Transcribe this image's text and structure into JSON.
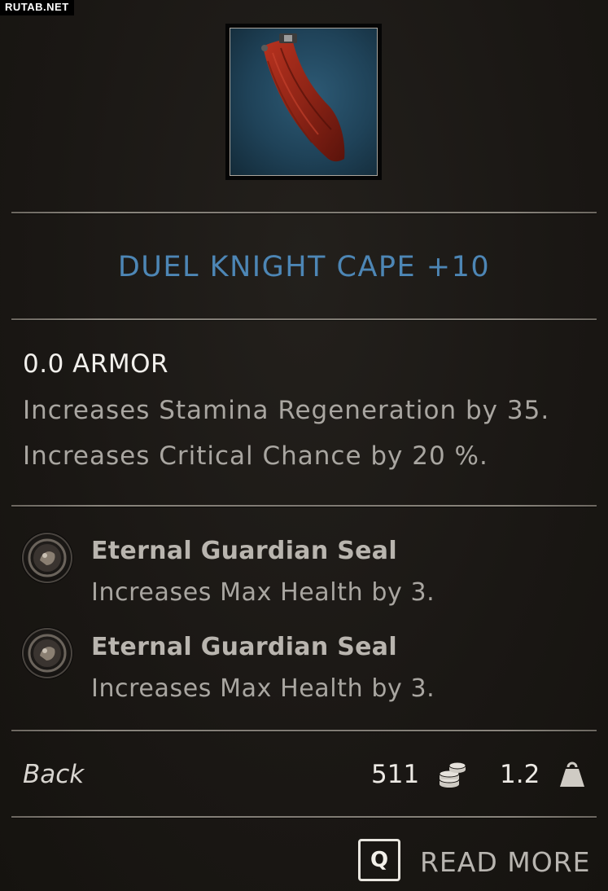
{
  "watermark": "RUTAB.NET",
  "item": {
    "icon": "red-cape-icon",
    "title": "DUEL KNIGHT CAPE +10",
    "title_color": "#4d86b5"
  },
  "stats": {
    "armor": "0.0 ARMOR",
    "bonuses": [
      "Increases Stamina Regeneration by 35.",
      "Increases Critical Chance by 20 %."
    ]
  },
  "gems": [
    {
      "icon": "guardian-seal-icon",
      "name": "Eternal Guardian Seal",
      "effect": "Increases Max Health by 3."
    },
    {
      "icon": "guardian-seal-icon",
      "name": "Eternal Guardian Seal",
      "effect": "Increases Max Health by 3."
    }
  ],
  "footer": {
    "slot": "Back",
    "price": "511",
    "price_icon": "coins-icon",
    "weight": "1.2",
    "weight_icon": "weight-icon"
  },
  "action": {
    "key": "Q",
    "label": "READ MORE"
  }
}
